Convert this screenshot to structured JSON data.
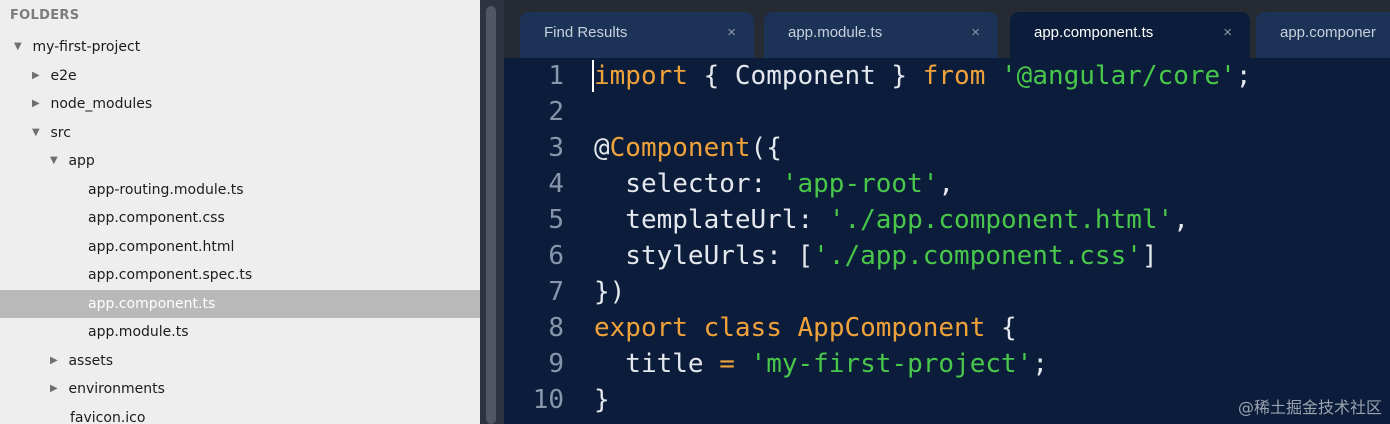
{
  "sidebar": {
    "header": "FOLDERS",
    "items": [
      {
        "label": "my-first-project",
        "expanded": true,
        "hasArrow": true,
        "depth": 0
      },
      {
        "label": "e2e",
        "expanded": false,
        "hasArrow": true,
        "depth": 1
      },
      {
        "label": "node_modules",
        "expanded": false,
        "hasArrow": true,
        "depth": 1
      },
      {
        "label": "src",
        "expanded": true,
        "hasArrow": true,
        "depth": 1
      },
      {
        "label": "app",
        "expanded": true,
        "hasArrow": true,
        "depth": 2
      },
      {
        "label": "app-routing.module.ts",
        "hasArrow": false,
        "depth": 3
      },
      {
        "label": "app.component.css",
        "hasArrow": false,
        "depth": 3
      },
      {
        "label": "app.component.html",
        "hasArrow": false,
        "depth": 3
      },
      {
        "label": "app.component.spec.ts",
        "hasArrow": false,
        "depth": 3
      },
      {
        "label": "app.component.ts",
        "hasArrow": false,
        "depth": 3,
        "selected": true
      },
      {
        "label": "app.module.ts",
        "hasArrow": false,
        "depth": 3
      },
      {
        "label": "assets",
        "expanded": false,
        "hasArrow": true,
        "depth": 2
      },
      {
        "label": "environments",
        "expanded": false,
        "hasArrow": true,
        "depth": 2
      },
      {
        "label": "favicon.ico",
        "hasArrow": false,
        "depth": 2
      }
    ]
  },
  "tabs": [
    {
      "label": "Find Results",
      "close": "×",
      "active": false
    },
    {
      "label": "app.module.ts",
      "close": "×",
      "active": false
    },
    {
      "label": "app.component.ts",
      "close": "×",
      "active": true
    },
    {
      "label": "app.componer",
      "close": "",
      "active": false
    }
  ],
  "editor": {
    "lines": [
      {
        "num": "1",
        "tokens": [
          {
            "t": "import",
            "c": "kw"
          },
          {
            "t": " { Component } ",
            "c": "plain"
          },
          {
            "t": "from",
            "c": "kw"
          },
          {
            "t": " ",
            "c": "plain"
          },
          {
            "t": "'@angular/core'",
            "c": "str"
          },
          {
            "t": ";",
            "c": "plain"
          }
        ]
      },
      {
        "num": "2",
        "tokens": []
      },
      {
        "num": "3",
        "tokens": [
          {
            "t": "@",
            "c": "plain"
          },
          {
            "t": "Component",
            "c": "dec"
          },
          {
            "t": "({",
            "c": "plain"
          }
        ]
      },
      {
        "num": "4",
        "tokens": [
          {
            "t": "  selector: ",
            "c": "plain"
          },
          {
            "t": "'app-root'",
            "c": "str"
          },
          {
            "t": ",",
            "c": "plain"
          }
        ]
      },
      {
        "num": "5",
        "tokens": [
          {
            "t": "  templateUrl: ",
            "c": "plain"
          },
          {
            "t": "'./app.component.html'",
            "c": "str"
          },
          {
            "t": ",",
            "c": "plain"
          }
        ]
      },
      {
        "num": "6",
        "tokens": [
          {
            "t": "  styleUrls: [",
            "c": "plain"
          },
          {
            "t": "'./app.component.css'",
            "c": "str"
          },
          {
            "t": "]",
            "c": "plain"
          }
        ]
      },
      {
        "num": "7",
        "tokens": [
          {
            "t": "})",
            "c": "plain"
          }
        ]
      },
      {
        "num": "8",
        "tokens": [
          {
            "t": "export",
            "c": "kw"
          },
          {
            "t": " ",
            "c": "plain"
          },
          {
            "t": "class",
            "c": "kw"
          },
          {
            "t": " ",
            "c": "plain"
          },
          {
            "t": "AppComponent",
            "c": "dec"
          },
          {
            "t": " {",
            "c": "plain"
          }
        ]
      },
      {
        "num": "9",
        "tokens": [
          {
            "t": "  title ",
            "c": "plain"
          },
          {
            "t": "=",
            "c": "op"
          },
          {
            "t": " ",
            "c": "plain"
          },
          {
            "t": "'my-first-project'",
            "c": "str"
          },
          {
            "t": ";",
            "c": "plain"
          }
        ]
      },
      {
        "num": "10",
        "tokens": [
          {
            "t": "}",
            "c": "plain"
          }
        ]
      }
    ]
  },
  "watermark": "@稀土掘金技术社区",
  "colors": {
    "editor_bg": "#0b1d3a",
    "keyword": "#f0a23a",
    "string": "#49c74b",
    "sidebar_bg": "#eeeeee",
    "selected_row": "#b9b9b9"
  }
}
